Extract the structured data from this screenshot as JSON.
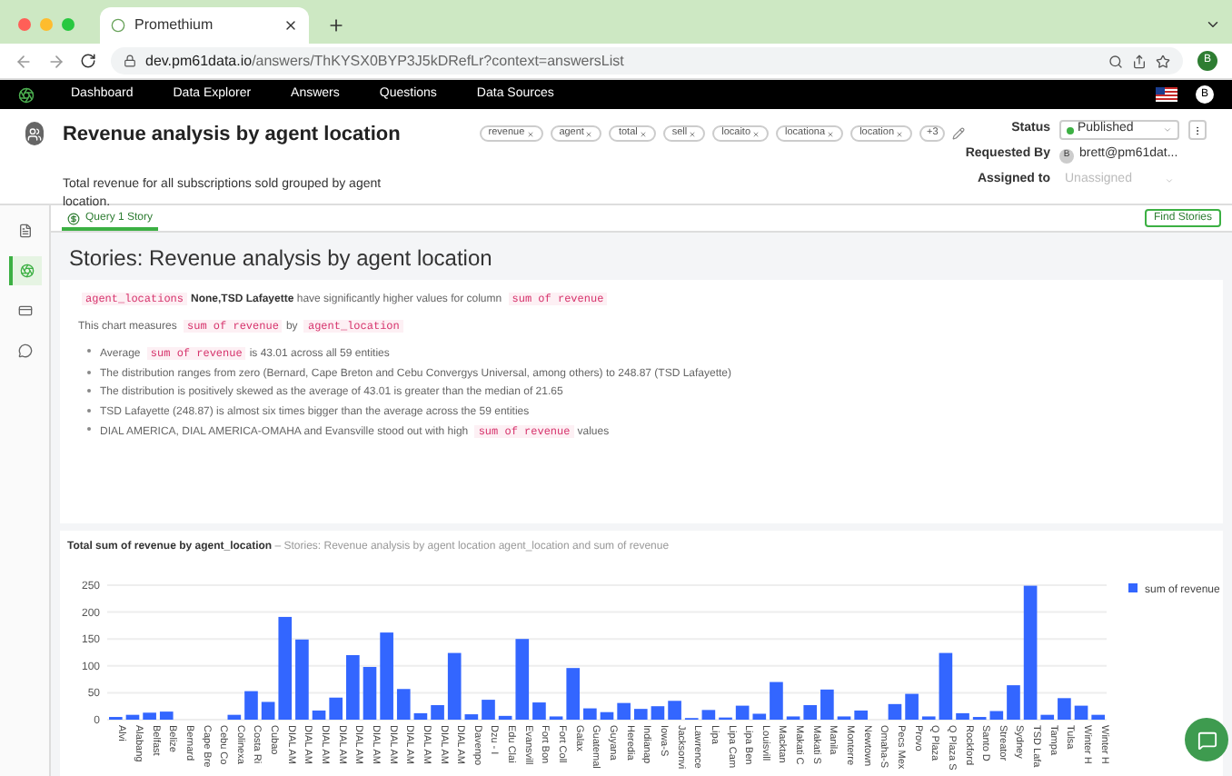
{
  "browser": {
    "tab_title": "Promethium",
    "url_host": "dev.pm61data.io",
    "url_path": "/answers/ThKYSX0BYP3J5kDRefLr?context=answersList",
    "profile_initial": "B"
  },
  "nav": [
    "Dashboard",
    "Data Explorer",
    "Answers",
    "Questions",
    "Data Sources"
  ],
  "user_initial": "B",
  "answer": {
    "title": "Revenue analysis by agent location",
    "description": "Total revenue for all subscriptions sold grouped by agent location.",
    "tags": [
      "revenue",
      "agent",
      "total",
      "sell",
      "locaito",
      "locationa",
      "location"
    ],
    "more_tags": "+3",
    "status_label": "Status",
    "status": "Published",
    "requested_by_label": "Requested By",
    "requester_initial": "B",
    "requested_by": "brett@pm61dat...",
    "assigned_label": "Assigned to",
    "assigned_placeholder": "Unassigned"
  },
  "rail": [
    {
      "selected": false
    },
    {
      "selected": true
    },
    {
      "selected": false
    },
    {
      "selected": false
    }
  ],
  "tabs": [
    {
      "label": "Query 1 Story",
      "selected": true
    }
  ],
  "find_button": "Find Stories",
  "story": {
    "heading": "Stories: Revenue analysis by agent location",
    "lines": [
      [
        {
          "kind": "code",
          "text": "agent_locations"
        },
        {
          "kind": "bold",
          "text": "None,TSD Lafayette"
        },
        {
          "kind": "text",
          "text": "have significantly higher values for column"
        },
        {
          "kind": "code",
          "text": "sum of revenue"
        }
      ],
      [
        {
          "kind": "text",
          "text": "This chart measures"
        },
        {
          "kind": "code",
          "text": "sum of revenue"
        },
        {
          "kind": "text",
          "text": "by"
        },
        {
          "kind": "code",
          "text": "agent_location"
        }
      ]
    ],
    "bullets": [
      [
        {
          "kind": "text",
          "text": "Average"
        },
        {
          "kind": "code",
          "text": "sum of revenue"
        },
        {
          "kind": "text",
          "text": "is 43.01 across all 59 entities"
        }
      ],
      [
        {
          "kind": "text",
          "text": "The distribution ranges from zero (Bernard, Cape Breton and Cebu Convergys Universal, among others) to 248.87 (TSD Lafayette)"
        }
      ],
      [
        {
          "kind": "text",
          "text": "The distribution is positively skewed as the average of 43.01 is greater than the median of 21.65"
        }
      ],
      [
        {
          "kind": "text",
          "text": "TSD Lafayette (248.87) is almost six times bigger than the average across the 59 entities"
        }
      ],
      [
        {
          "kind": "text",
          "text": "DIAL AMERICA, DIAL AMERICA-OMAHA and Evansville stood out with high"
        },
        {
          "kind": "code",
          "text": "sum of revenue"
        },
        {
          "kind": "text",
          "text": "values"
        }
      ]
    ]
  },
  "chart": {
    "title": "Total sum of revenue by agent_location",
    "subtitle": "– Stories: Revenue analysis by agent location agent_location and sum of revenue",
    "chart_data": {
      "type": "bar",
      "categories": [
        "Alvi",
        "Alabang",
        "Belfast",
        "Belize",
        "Bernard",
        "Cape Bre",
        "Cebu Co",
        "Colinexa",
        "Costa Ri",
        "Cubao",
        "DIAL AM",
        "DIAL AM",
        "DIAL AM",
        "DIAL AM",
        "DIAL AM",
        "DIAL AM",
        "DIAL AM",
        "DIAL AM",
        "DIAL AM",
        "DIAL AM",
        "DIAL AM",
        "Davenpo",
        "Dzu - I",
        "Edu Clai",
        "Evansvill",
        "Fort Bon",
        "Fort Coll",
        "Galax",
        "Guatemal",
        "Guyana",
        "Heredia",
        "Indianap",
        "Iowa-S",
        "Jacksonvi",
        "Lawrence",
        "Lipa",
        "Lipa Cam",
        "Lipa Ben",
        "Louisvill",
        "Macktan",
        "Makati C",
        "Makati S",
        "Manila",
        "Monterre",
        "Newtown",
        "Omaha-S",
        "Pecs Mex",
        "Provo",
        "Q Plaza",
        "Q Plaza S",
        "Rockford",
        "Santo D",
        "Streator",
        "Sydney",
        "TSD Lafa",
        "Tampa",
        "Tulsa",
        "Winter H",
        "Winter H"
      ],
      "series": [
        {
          "name": "sum of revenue",
          "color": "#3366ff",
          "values": [
            5,
            9,
            13,
            15,
            0,
            0,
            0,
            9,
            53,
            33,
            191,
            149,
            17,
            41,
            120,
            98,
            162,
            57,
            12,
            27,
            124,
            10,
            37,
            7,
            150,
            32,
            6,
            96,
            21,
            14,
            31,
            20,
            25,
            35,
            3,
            18,
            4,
            26,
            11,
            70,
            6,
            27,
            56,
            6,
            17,
            0,
            29,
            48,
            6,
            124,
            12,
            5,
            16,
            64,
            249,
            9,
            40,
            26,
            9
          ]
        }
      ],
      "ylim": [
        0,
        250
      ],
      "grid": true,
      "yticks": [
        0,
        50,
        100,
        150,
        200,
        250
      ]
    }
  }
}
